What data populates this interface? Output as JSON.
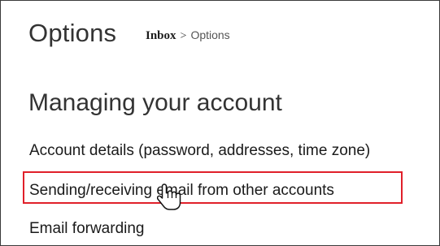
{
  "header": {
    "title": "Options",
    "breadcrumb": {
      "inbox": "Inbox",
      "separator": ">",
      "current": "Options"
    }
  },
  "section": {
    "heading": "Managing your account",
    "items": [
      {
        "label": "Account details (password, addresses, time zone)"
      },
      {
        "label": "Sending/receiving email from other accounts",
        "highlighted": true
      },
      {
        "label": "Email forwarding"
      }
    ]
  },
  "overlay": {
    "highlight_color": "#e0202a",
    "cursor_icon": "hand-pointer-icon"
  }
}
